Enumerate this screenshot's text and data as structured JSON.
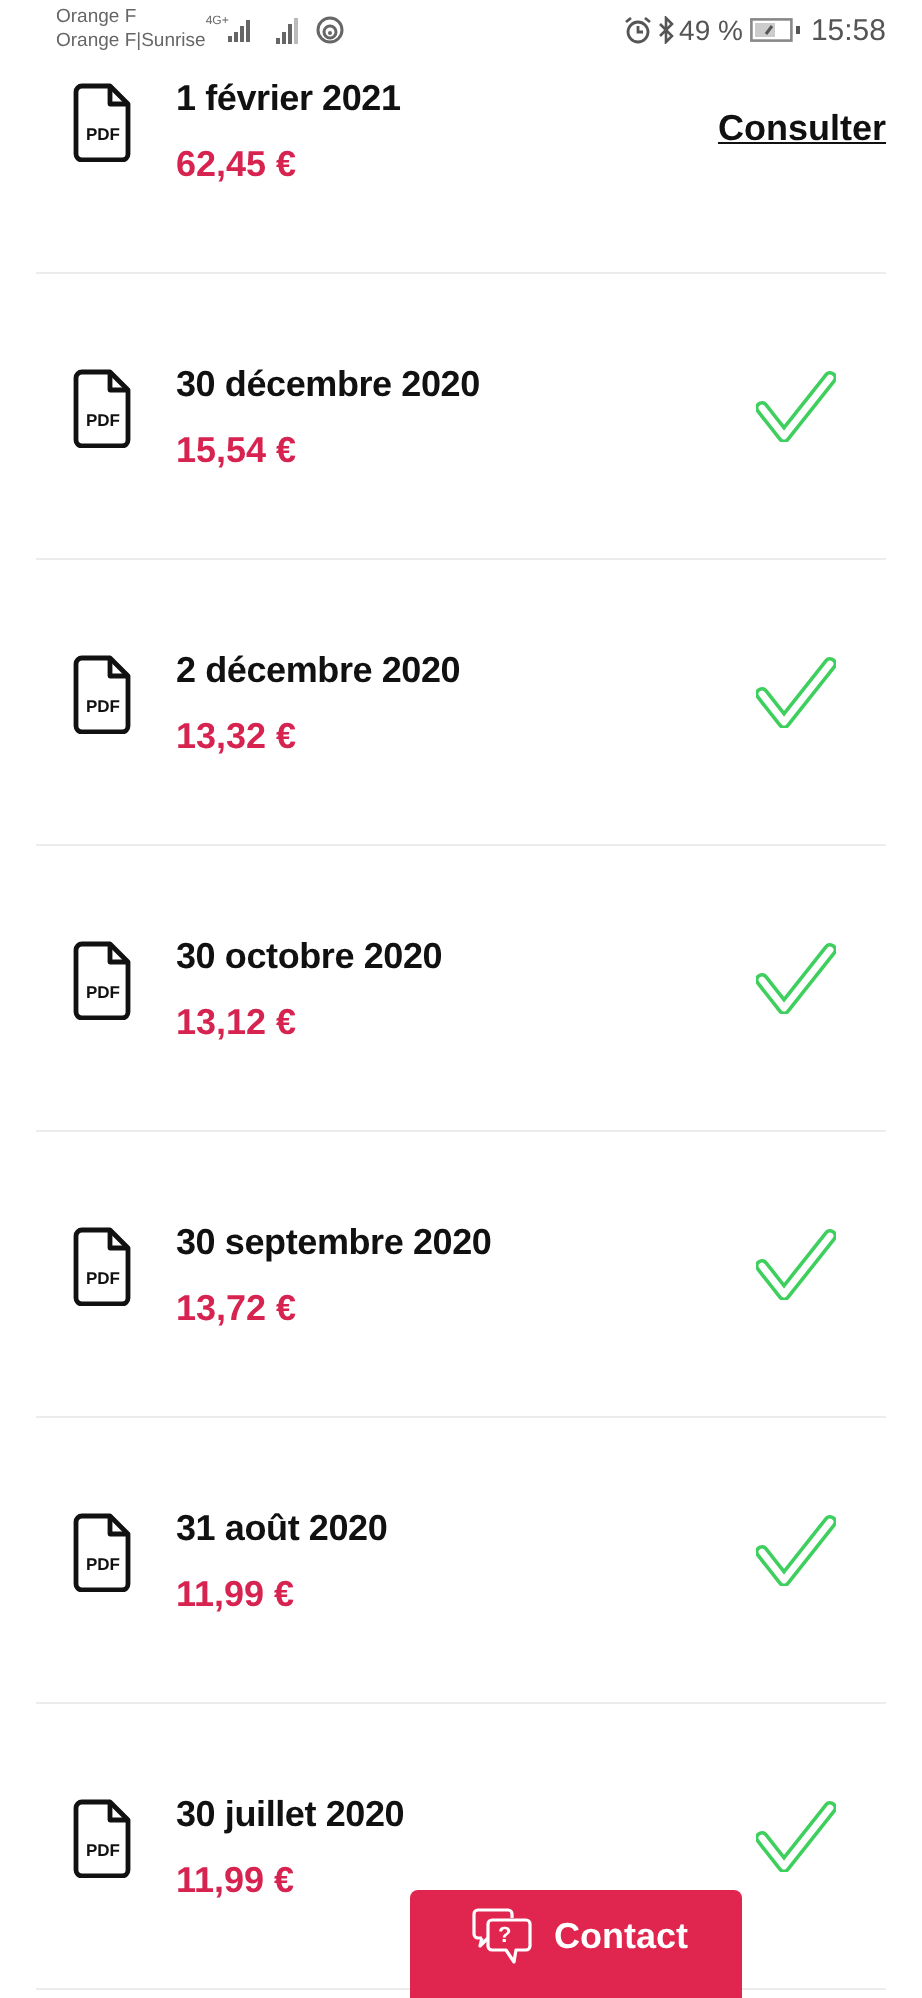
{
  "status_bar": {
    "carriers": [
      "Orange F",
      "Orange F|Sunrise"
    ],
    "network": "4G+",
    "battery_percent": "49 %",
    "time": "15:58"
  },
  "invoices": [
    {
      "date": "1 février 2021",
      "amount": "62,45 €",
      "file_type": "PDF",
      "kind": "link",
      "action": "Consulter"
    },
    {
      "date": "30 décembre 2020",
      "amount": "15,54 €",
      "file_type": "PDF",
      "kind": "paid"
    },
    {
      "date": "2 décembre 2020",
      "amount": "13,32 €",
      "file_type": "PDF",
      "kind": "paid"
    },
    {
      "date": "30 octobre 2020",
      "amount": "13,12 €",
      "file_type": "PDF",
      "kind": "paid"
    },
    {
      "date": "30 septembre 2020",
      "amount": "13,72 €",
      "file_type": "PDF",
      "kind": "paid"
    },
    {
      "date": "31 août 2020",
      "amount": "11,99 €",
      "file_type": "PDF",
      "kind": "paid"
    },
    {
      "date": "30 juillet 2020",
      "amount": "11,99 €",
      "file_type": "PDF",
      "kind": "paid"
    }
  ],
  "contact_button": {
    "label": "Contact",
    "icon_glyph": "?"
  }
}
